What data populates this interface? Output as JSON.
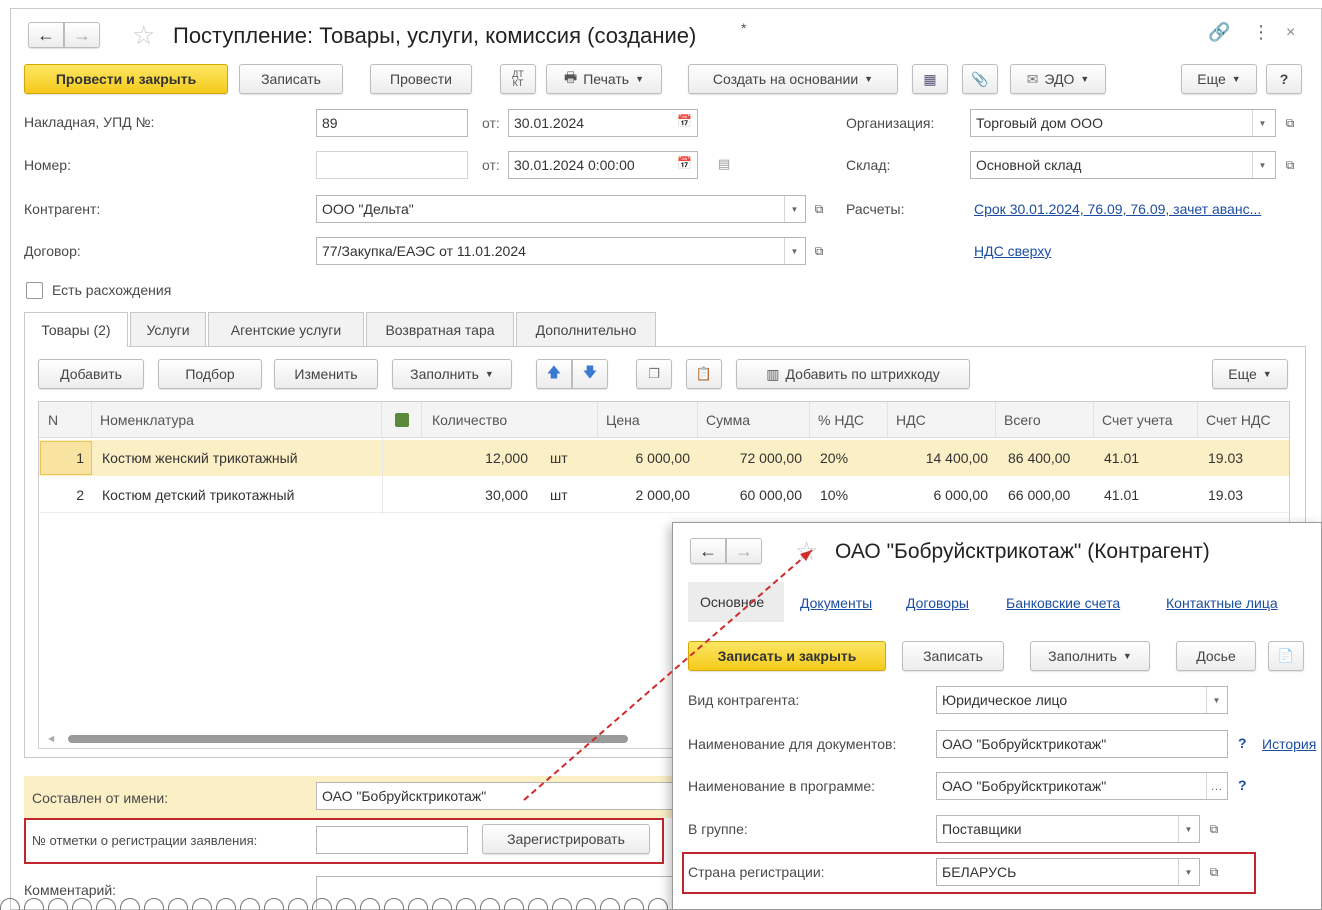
{
  "main_window": {
    "title": "Поступление: Товары, услуги, комиссия (создание)",
    "title_marker": "*",
    "toolbar": {
      "post_close": "Провести и закрыть",
      "save": "Записать",
      "post": "Провести",
      "dtkt": "Дт Кт",
      "print": "Печать",
      "create_basis": "Создать на основании",
      "edo": "ЭДО",
      "more": "Еще",
      "help": "?"
    },
    "fields": {
      "invoice_label": "Накладная, УПД №:",
      "invoice_value": "89",
      "from_label": "от:",
      "invoice_date": "30.01.2024",
      "number_label": "Номер:",
      "number_value": "",
      "number_date": "30.01.2024 0:00:00",
      "org_label": "Организация:",
      "org_value": "Торговый дом ООО",
      "warehouse_label": "Склад:",
      "warehouse_value": "Основной склад",
      "counterparty_label": "Контрагент:",
      "counterparty_value": "ООО \"Дельта\"",
      "settlements_label": "Расчеты:",
      "settlements_link": "Срок 30.01.2024, 76.09, 76.09, зачет аванс...",
      "contract_label": "Договор:",
      "contract_value": "77/Закупка/ЕАЭС от 11.01.2024",
      "vat_link": "НДС сверху",
      "discrepancy_label": "Есть расхождения"
    },
    "tabs": [
      "Товары (2)",
      "Услуги",
      "Агентские услуги",
      "Возвратная тара",
      "Дополнительно"
    ],
    "table_toolbar": {
      "add": "Добавить",
      "select": "Подбор",
      "change": "Изменить",
      "fill": "Заполнить",
      "barcode": "Добавить по штрихкоду",
      "more": "Еще"
    },
    "table": {
      "columns": [
        "N",
        "Номенклатура",
        "Количество",
        "Цена",
        "Сумма",
        "% НДС",
        "НДС",
        "Всего",
        "Счет учета",
        "Счет НДС"
      ],
      "rows": [
        {
          "n": "1",
          "name": "Костюм женский трикотажный",
          "qty": "12,000",
          "unit": "шт",
          "price": "6 000,00",
          "sum": "72 000,00",
          "vat_rate": "20%",
          "vat": "14 400,00",
          "total": "86 400,00",
          "account": "41.01",
          "vat_account": "19.03"
        },
        {
          "n": "2",
          "name": "Костюм детский трикотажный",
          "qty": "30,000",
          "unit": "шт",
          "price": "2 000,00",
          "sum": "60 000,00",
          "vat_rate": "10%",
          "vat": "6 000,00",
          "total": "66 000,00",
          "account": "41.01",
          "vat_account": "19.03"
        }
      ]
    },
    "bottom": {
      "composed_label": "Составлен от имени:",
      "composed_value": "ОАО \"Бобруйсктрикотаж\"",
      "reg_label": "№ отметки о регистрации заявления:",
      "reg_value": "",
      "register_button": "Зарегистрировать",
      "comment_label": "Комментарий:"
    }
  },
  "popup_window": {
    "title": "ОАО \"Бобруйсктрикотаж\" (Контрагент)",
    "nav": [
      "Основное",
      "Документы",
      "Договоры",
      "Банковские счета",
      "Контактные лица"
    ],
    "toolbar": {
      "save_close": "Записать и закрыть",
      "save": "Записать",
      "fill": "Заполнить",
      "dossier": "Досье"
    },
    "fields": {
      "type_label": "Вид контрагента:",
      "type_value": "Юридическое лицо",
      "docname_label": "Наименование для документов:",
      "docname_value": "ОАО \"Бобруйсктрикотаж\"",
      "history_link": "История",
      "progname_label": "Наименование в программе:",
      "progname_value": "ОАО \"Бобруйсктрикотаж\"",
      "group_label": "В группе:",
      "group_value": "Поставщики",
      "country_label": "Страна регистрации:",
      "country_value": "БЕЛАРУСЬ"
    }
  },
  "colors": {
    "accent_yellow": "#f5ca1a",
    "selected_row": "#fbefc6",
    "highlight_frame": "#c0262d",
    "link": "#1c4ea0"
  }
}
